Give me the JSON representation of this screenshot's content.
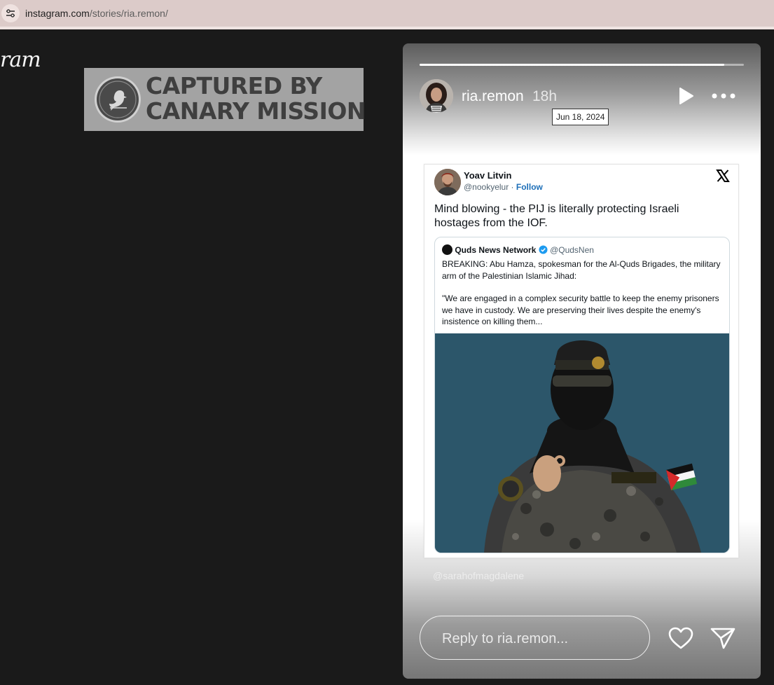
{
  "browser": {
    "url_host": "instagram.com",
    "url_path": "/stories/ria.remon/",
    "site_info_icon": "tune-icon"
  },
  "page": {
    "logo_fragment": "ram"
  },
  "watermark": {
    "line1": "CAPTURED BY",
    "line2": "CANARY MISSION",
    "logo_icon": "canary-bird-icon"
  },
  "story": {
    "progress": 0.94,
    "username": "ria.remon",
    "time_ago": "18h",
    "tooltip_date": "Jun 18, 2024",
    "credit": "@sarahofmagdalene",
    "reply_placeholder": "Reply to ria.remon...",
    "icons": {
      "play": "play-icon",
      "more": "more-options-icon",
      "like": "heart-icon",
      "share": "send-icon"
    }
  },
  "tweet": {
    "author_name": "Yoav Litvin",
    "author_handle": "@nookyelur",
    "separator": " · ",
    "follow_label": "Follow",
    "text": "Mind blowing - the PIJ is literally protecting Israeli hostages from the IOF.",
    "platform_icon": "x-logo-icon",
    "quote": {
      "author_name": "Quds News Network",
      "author_handle": "@QudsNen",
      "paragraph1": "BREAKING: Abu Hamza, spokesman for the Al-Quds Brigades, the military arm of the Palestinian Islamic Jihad:",
      "paragraph2": "\"We are engaged in a complex security battle to keep the enemy prisoners we have in custody. We are preserving their lives despite the enemy's insistence on killing them..."
    }
  },
  "colors": {
    "page_background": "#1a1a1a",
    "address_bar": "#dccbc9",
    "follow_link": "#1d6fb8",
    "verified_badge": "#1d9bf0"
  }
}
